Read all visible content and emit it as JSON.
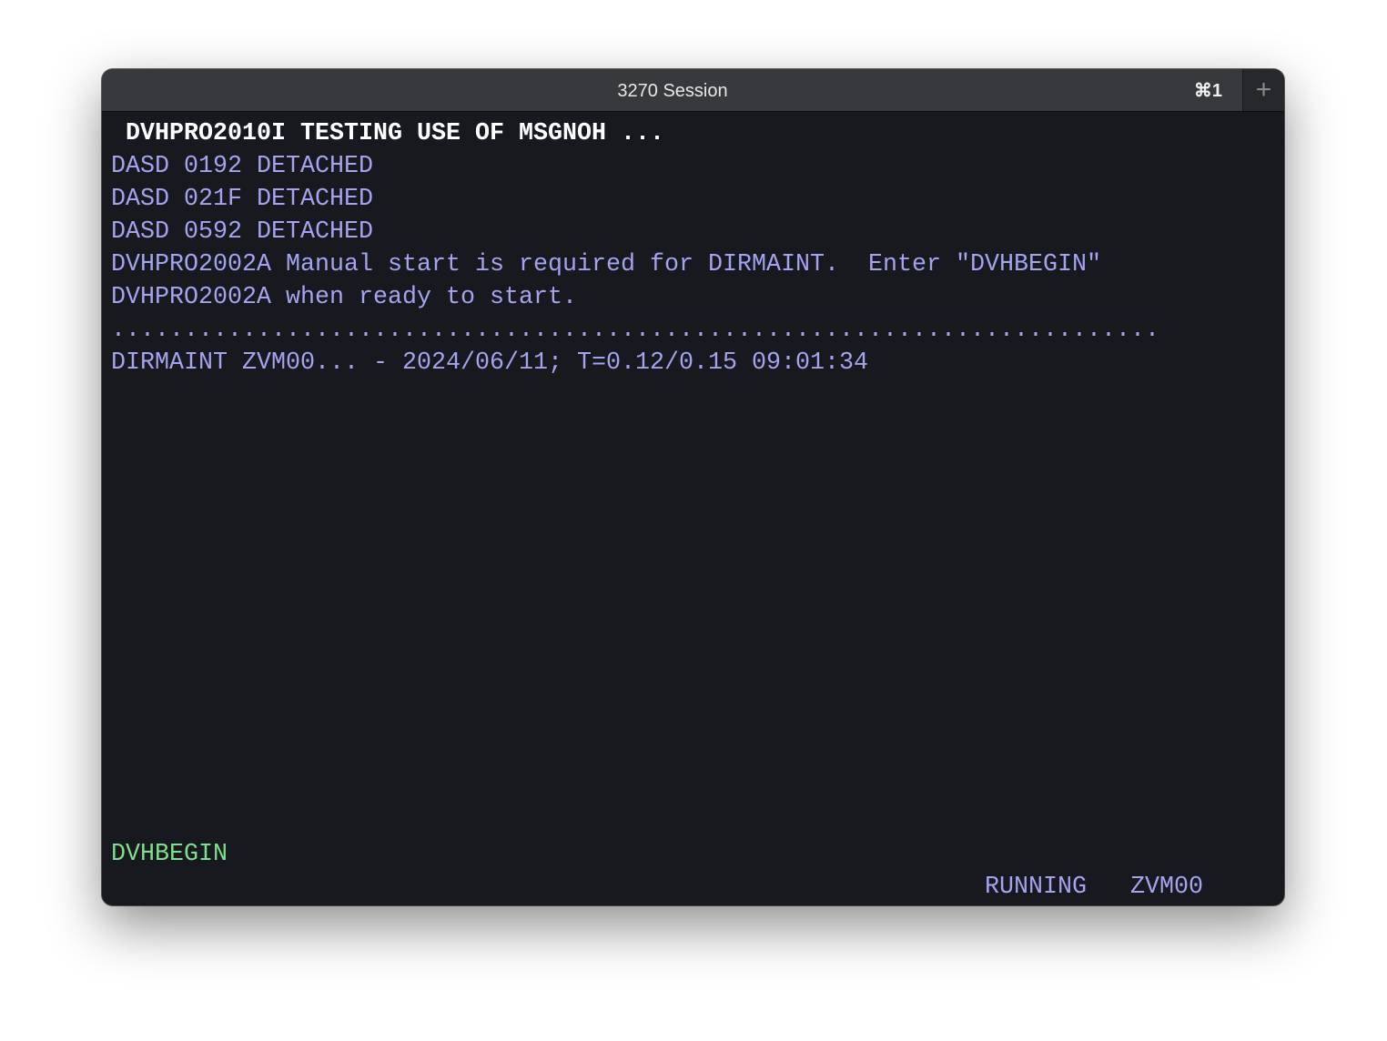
{
  "window": {
    "title": "3270 Session",
    "shortcut": "⌘1",
    "new_tab_icon": "plus-icon"
  },
  "terminal": {
    "colors": {
      "background": "#17191e",
      "default": "#a3a3f0",
      "highlight": "#ffffff",
      "input": "#7ee08c"
    },
    "lines": [
      " DVHPRO2010I TESTING USE OF MSGNOH ...",
      "DASD 0192 DETACHED",
      "DASD 021F DETACHED",
      "DASD 0592 DETACHED",
      "DVHPRO2002A Manual start is required for DIRMAINT.  Enter \"DVHBEGIN\"",
      "DVHPRO2002A when ready to start.",
      "........................................................................",
      "DIRMAINT ZVM00... - 2024/06/11; T=0.12/0.15 09:01:34"
    ],
    "input_line": "DVHBEGIN",
    "status": "RUNNING",
    "system": "ZVM00"
  }
}
